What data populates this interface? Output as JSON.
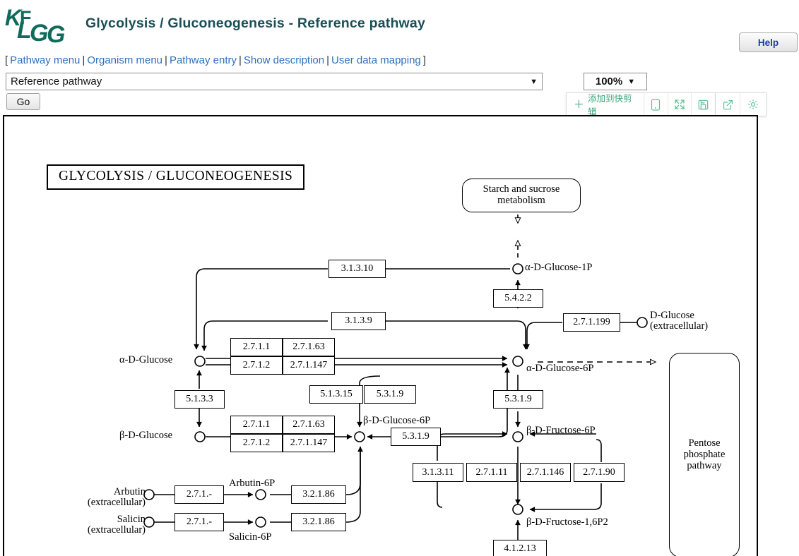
{
  "header": {
    "logo_alt": "KEGG",
    "title": "Glycolysis / Gluconeogenesis - Reference pathway",
    "help_label": "Help"
  },
  "navbar": {
    "open_bracket": "[",
    "close_bracket": "]",
    "separator": "|",
    "links": [
      "Pathway menu",
      "Organism menu",
      "Pathway entry",
      "Show description",
      "User data mapping"
    ]
  },
  "controls": {
    "pathway_select_value": "Reference pathway",
    "pathway_select_caret": "▼",
    "zoom_select_value": "100%",
    "zoom_select_caret": "▼",
    "go_label": "Go"
  },
  "clip_toolbar": {
    "add_label": "添加到快剪辑",
    "plus": "＋",
    "icons": [
      "mobile-icon",
      "expand-icon",
      "save-icon",
      "share-icon",
      "settings-icon"
    ],
    "accent_color": "#3aa37a"
  },
  "map": {
    "map_title": "GLYCOLYSIS / GLUCONEOGENESIS",
    "linked_maps": [
      {
        "id": "starch-sucrose",
        "label_line1": "Starch and sucrose",
        "label_line2": "metabolism"
      },
      {
        "id": "pentose-phosphate",
        "label_line1": "Pentose",
        "label_line2": "phosphate",
        "label_line3": "pathway"
      }
    ],
    "compounds": [
      {
        "id": "alpha-d-glucose-1p",
        "label": "α-D-Glucose-1P"
      },
      {
        "id": "alpha-d-glucose",
        "label": "α-D-Glucose"
      },
      {
        "id": "beta-d-glucose",
        "label": "β-D-Glucose"
      },
      {
        "id": "d-glucose-extracellular",
        "label_line1": "D-Glucose",
        "label_line2": "(extracellular)"
      },
      {
        "id": "alpha-d-glucose-6p",
        "label": "α-D-Glucose-6P"
      },
      {
        "id": "beta-d-glucose-6p",
        "label": "β-D-Glucose-6P"
      },
      {
        "id": "beta-d-fructose-6p",
        "label": "β-D-Fructose-6P"
      },
      {
        "id": "beta-d-fructose-16p2",
        "label": "β-D-Fructose-1,6P2"
      },
      {
        "id": "arbutin-extracellular",
        "label_line1": "Arbutin",
        "label_line2": "(extracellular)"
      },
      {
        "id": "salicin-extracellular",
        "label_line1": "Salicin",
        "label_line2": "(extracellular)"
      },
      {
        "id": "arbutin-6p",
        "label": "Arbutin-6P"
      },
      {
        "id": "salicin-6p",
        "label": "Salicin-6P"
      }
    ],
    "enzymes": [
      {
        "id": "ec-3-1-3-10",
        "label": "3.1.3.10"
      },
      {
        "id": "ec-5-4-2-2",
        "label": "5.4.2.2"
      },
      {
        "id": "ec-3-1-3-9",
        "label": "3.1.3.9"
      },
      {
        "id": "ec-2-7-1-199",
        "label": "2.7.1.199"
      },
      {
        "id": "ec-2-7-1-1-a",
        "label": "2.7.1.1"
      },
      {
        "id": "ec-2-7-1-63-a",
        "label": "2.7.1.63"
      },
      {
        "id": "ec-2-7-1-2-a",
        "label": "2.7.1.2"
      },
      {
        "id": "ec-2-7-1-147-a",
        "label": "2.7.1.147"
      },
      {
        "id": "ec-5-1-3-3",
        "label": "5.1.3.3"
      },
      {
        "id": "ec-5-1-3-15",
        "label": "5.1.3.15"
      },
      {
        "id": "ec-5-3-1-9-a",
        "label": "5.3.1.9"
      },
      {
        "id": "ec-5-3-1-9-b",
        "label": "5.3.1.9"
      },
      {
        "id": "ec-2-7-1-1-b",
        "label": "2.7.1.1"
      },
      {
        "id": "ec-2-7-1-63-b",
        "label": "2.7.1.63"
      },
      {
        "id": "ec-2-7-1-2-b",
        "label": "2.7.1.2"
      },
      {
        "id": "ec-2-7-1-147-b",
        "label": "2.7.1.147"
      },
      {
        "id": "ec-5-3-1-9-c",
        "label": "5.3.1.9"
      },
      {
        "id": "ec-3-1-3-11",
        "label": "3.1.3.11"
      },
      {
        "id": "ec-2-7-1-11",
        "label": "2.7.1.11"
      },
      {
        "id": "ec-2-7-1-146",
        "label": "2.7.1.146"
      },
      {
        "id": "ec-2-7-1-90",
        "label": "2.7.1.90"
      },
      {
        "id": "ec-2-7-1-dash-a",
        "label": "2.7.1.-"
      },
      {
        "id": "ec-2-7-1-dash-b",
        "label": "2.7.1.-"
      },
      {
        "id": "ec-3-2-1-86-a",
        "label": "3.2.1.86"
      },
      {
        "id": "ec-3-2-1-86-b",
        "label": "3.2.1.86"
      },
      {
        "id": "ec-4-1-2-13",
        "label": "4.1.2.13"
      }
    ]
  }
}
